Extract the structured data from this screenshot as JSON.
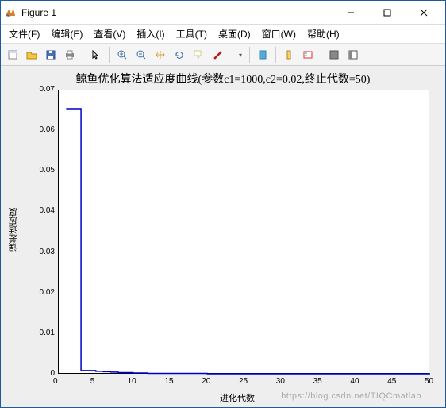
{
  "window": {
    "title": "Figure 1"
  },
  "menu": {
    "file": "文件(F)",
    "edit": "编辑(E)",
    "view": "查看(V)",
    "insert": "插入(I)",
    "tools": "工具(T)",
    "desktop": "桌面(D)",
    "window": "窗口(W)",
    "help": "帮助(H)"
  },
  "chart_data": {
    "type": "line",
    "title": "鲸鱼优化算法适应度曲线(参数c1=1000,c2=0.02,终止代数=50)",
    "xlabel": "进化代数",
    "ylabel": "误差适应度",
    "xlim": [
      0,
      50
    ],
    "ylim": [
      0,
      0.07
    ],
    "xticks": [
      0,
      5,
      10,
      15,
      20,
      25,
      30,
      35,
      40,
      45,
      50
    ],
    "yticks": [
      0,
      0.01,
      0.02,
      0.03,
      0.04,
      0.05,
      0.06,
      0.07
    ],
    "x": [
      1,
      2,
      3,
      4,
      5,
      6,
      7,
      8,
      9,
      10,
      12,
      15,
      20,
      25,
      30,
      35,
      40,
      45,
      50
    ],
    "y": [
      0.0655,
      0.0655,
      0.001,
      0.001,
      0.0008,
      0.0007,
      0.0006,
      0.0005,
      0.0005,
      0.0004,
      0.0003,
      0.0003,
      0.0002,
      0.0002,
      0.0002,
      0.0002,
      0.0002,
      0.0002,
      0.0002
    ]
  },
  "watermark": "https://blog.csdn.net/TIQCmatlab"
}
